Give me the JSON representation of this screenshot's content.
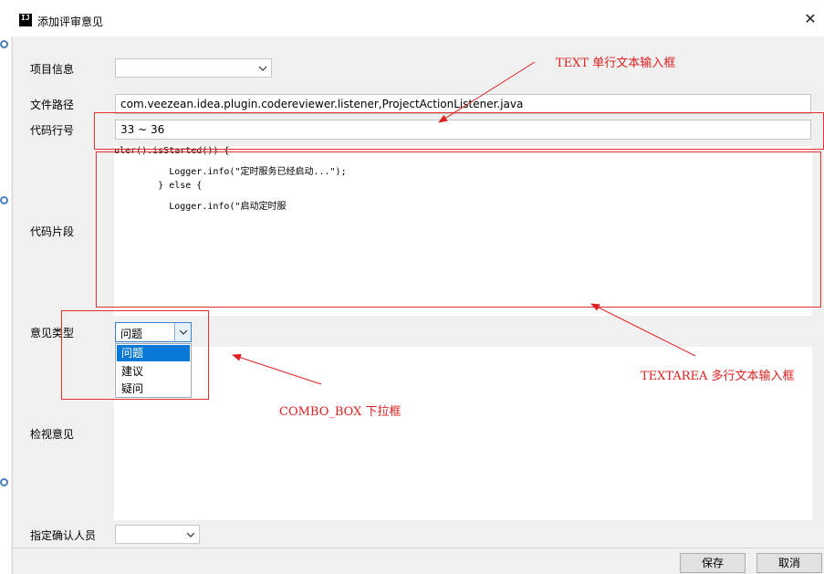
{
  "window": {
    "title": "添加评审意见",
    "app_icon_text": "IJ"
  },
  "form": {
    "project_info": {
      "label": "项目信息",
      "value": ""
    },
    "file_path": {
      "label": "文件路径",
      "value": "com.veezean.idea.plugin.codereviewer.listener,ProjectActionListener.java"
    },
    "line_numbers": {
      "label": "代码行号",
      "value": "33 ~ 36"
    },
    "code_snippet": {
      "label": "代码片段",
      "lines": [
        "uler().isStarted()) {",
        "          Logger.info(\"定时服务已经启动...\");",
        "        } else {",
        "          Logger.info(\"启动定时服"
      ]
    },
    "opinion_type": {
      "label": "意见类型",
      "value": "问题",
      "options": [
        "问题",
        "建议",
        "疑问"
      ],
      "selected_index": 0
    },
    "review_comment": {
      "label": "检视意见",
      "value": ""
    },
    "confirm_person": {
      "label": "指定确认人员",
      "value": ""
    }
  },
  "buttons": {
    "save": "保存",
    "cancel": "取消"
  },
  "annotations": {
    "text": "TEXT 单行文本输入框",
    "textarea": "TEXTAREA 多行文本输入框",
    "combo": "COMBO_BOX  下拉框",
    "color": "#e02020"
  }
}
